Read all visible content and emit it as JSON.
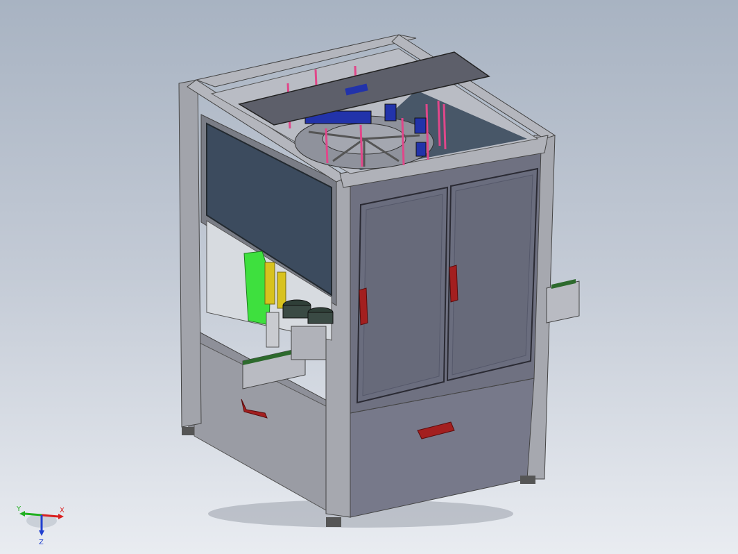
{
  "viewport": {
    "background_top": "#a8b3c2",
    "background_bottom": "#e9ecf1"
  },
  "model": {
    "description_colors": {
      "frame": "#8d8f99",
      "panel": "#6b6d79",
      "glass": "#3c4b5e",
      "handle": "#a31f1f",
      "carousel_blue": "#2233aa",
      "rod_pink": "#e0478a",
      "green_part": "#3ee03e",
      "yellow_part": "#d8c21e"
    }
  },
  "triad": {
    "x_label": "X",
    "y_label": "Y",
    "z_label": "Z",
    "x_color": "#d92020",
    "y_color": "#20b020",
    "z_color": "#2040d0"
  }
}
